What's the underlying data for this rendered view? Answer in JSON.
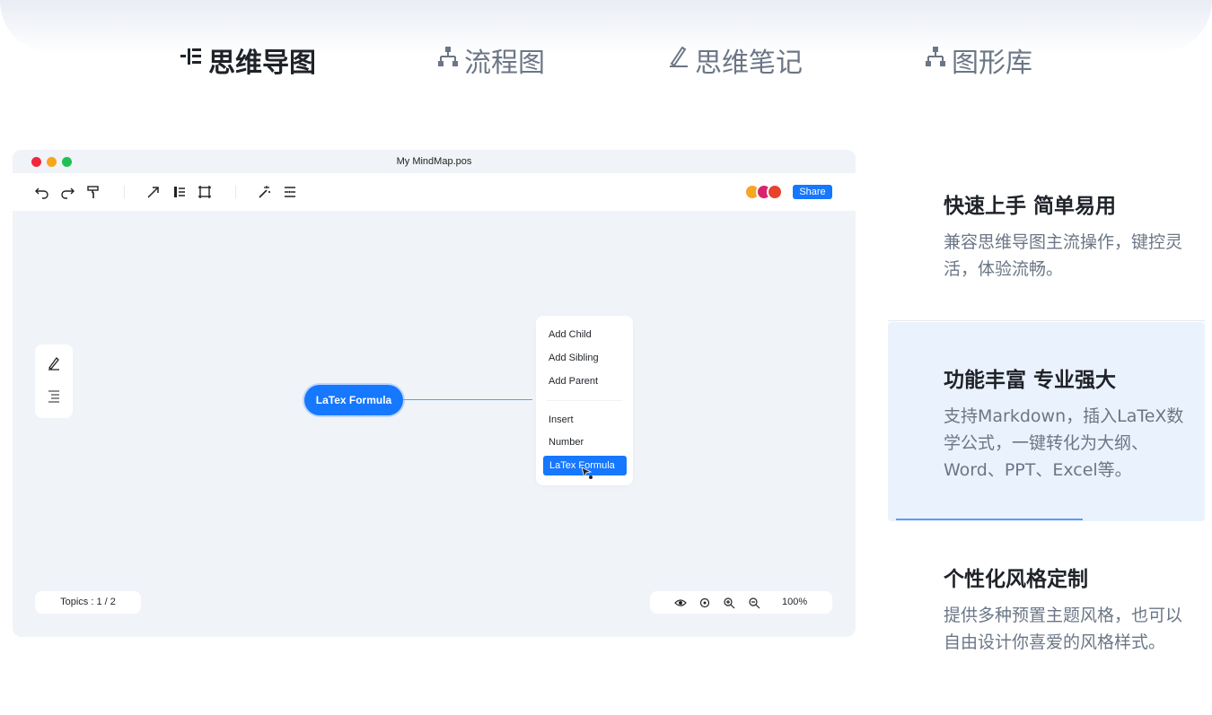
{
  "tabs": [
    {
      "label": "思维导图",
      "icon": "mindmap-icon",
      "active": true
    },
    {
      "label": "流程图",
      "icon": "flowchart-icon",
      "active": false
    },
    {
      "label": "思维笔记",
      "icon": "pen-icon",
      "active": false
    },
    {
      "label": "图形库",
      "icon": "flowchart-icon",
      "active": false
    }
  ],
  "app": {
    "window_title": "My MindMap.pos",
    "traffic_light_colors": [
      "#f0283c",
      "#f7a51a",
      "#1fc157"
    ],
    "share_label": "Share",
    "avatar_colors": [
      "#f5a623",
      "#d6246e",
      "#e8432d"
    ],
    "toolbar_icons": [
      "undo-icon",
      "redo-icon",
      "format-painter-icon",
      "arrow-icon",
      "layout-icon",
      "frame-icon",
      "magic-wand-icon",
      "outline-icon"
    ],
    "root_node": "LaTex Formula",
    "context_menu": {
      "items_group1": [
        "Add Child",
        "Add Sibling",
        "Add Parent"
      ],
      "items_group2": [
        "Insert",
        "Number"
      ],
      "selected": "LaTex Formula"
    },
    "topics_label": "Topics : 1 / 2",
    "zoom_level": "100%",
    "accent_color": "#1677ff"
  },
  "features": [
    {
      "title": "快速上手 简单易用",
      "desc": "兼容思维导图主流操作，键控灵活，体验流畅。",
      "active": false
    },
    {
      "title": "功能丰富 专业强大",
      "desc": "支持Markdown，插入LaTeX数学公式，一键转化为大纲、Word、PPT、Excel等。",
      "active": true
    },
    {
      "title": "个性化风格定制",
      "desc": "提供多种预置主题风格，也可以自由设计你喜爱的风格样式。",
      "active": false
    }
  ]
}
